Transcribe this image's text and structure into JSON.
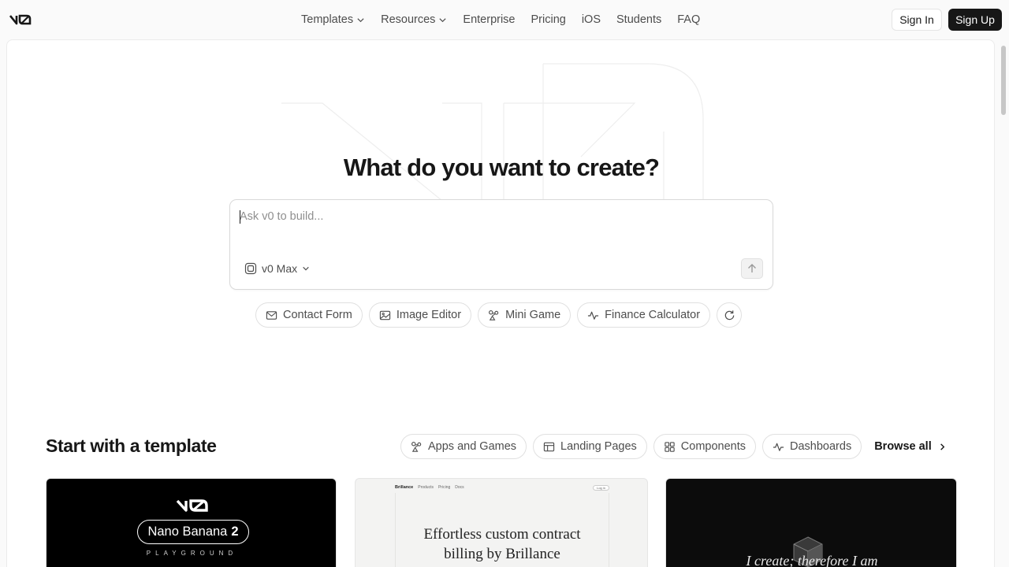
{
  "nav": {
    "links": [
      {
        "label": "Templates",
        "dropdown": true
      },
      {
        "label": "Resources",
        "dropdown": true
      },
      {
        "label": "Enterprise",
        "dropdown": false
      },
      {
        "label": "Pricing",
        "dropdown": false
      },
      {
        "label": "iOS",
        "dropdown": false
      },
      {
        "label": "Students",
        "dropdown": false
      },
      {
        "label": "FAQ",
        "dropdown": false
      }
    ],
    "sign_in": "Sign In",
    "sign_up": "Sign Up"
  },
  "hero": {
    "title": "What do you want to create?",
    "prompt_placeholder": "Ask v0 to build...",
    "model_label": "v0 Max"
  },
  "suggestions": [
    "Contact Form",
    "Image Editor",
    "Mini Game",
    "Finance Calculator"
  ],
  "templates": {
    "title": "Start with a template",
    "categories": [
      "Apps and Games",
      "Landing Pages",
      "Components",
      "Dashboards"
    ],
    "browse_all": "Browse all",
    "cards": [
      {
        "pill_text": "Nano Banana",
        "pill_num": "2",
        "subtitle": "PLAYGROUND"
      },
      {
        "brand": "Brillance",
        "nav": [
          "Products",
          "Pricing",
          "Docs"
        ],
        "login": "Log in",
        "headline_1": "Effortless custom contract",
        "headline_2": "billing by Brillance"
      },
      {
        "headline": "I create; therefore I am"
      }
    ]
  },
  "colors": {
    "accent_dark": "#171717",
    "border": "#e0e0e0",
    "muted_text": "#4d4d4d"
  }
}
